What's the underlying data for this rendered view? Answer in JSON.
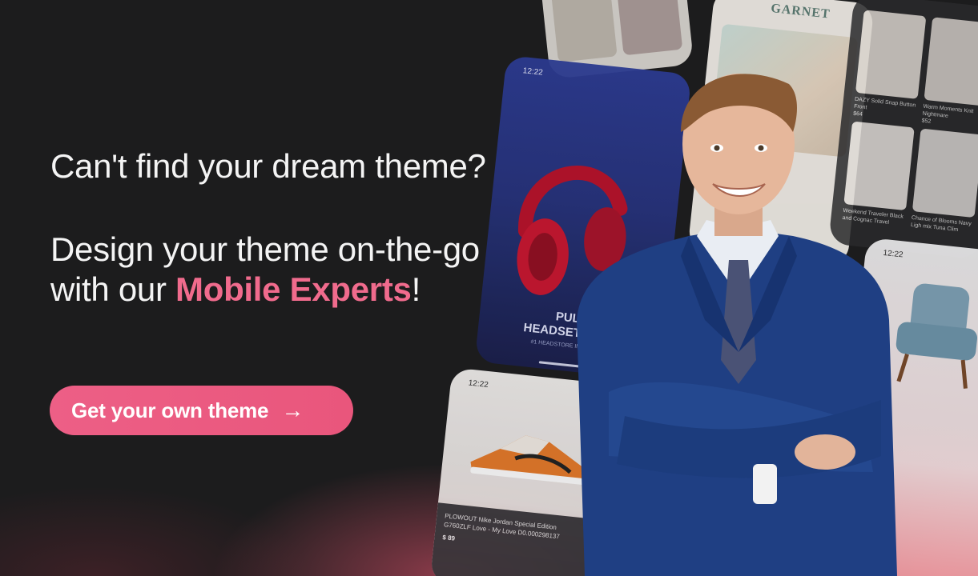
{
  "headline": {
    "line1": "Can't find your dream theme?",
    "line2": "Design your theme on-the-go",
    "line3_prefix": "with our ",
    "line3_accent": "Mobile Experts",
    "line3_suffix": "!"
  },
  "cta": {
    "label": "Get your own theme",
    "arrow": "→"
  },
  "mockups": {
    "headset": {
      "time": "12:22",
      "title_line1": "PULSE",
      "title_line2": "HEADSET STORE",
      "subtitle": "#1 HEADSTORE IN THE WORLD"
    },
    "garnet": {
      "logo": "GARNET"
    },
    "grid": {
      "item1": "DAZY Solid Snap Button Front",
      "item1_price": "$64",
      "item2": "Warm Moments Knit Nightmare",
      "item2_price": "$52",
      "item3": "Weekend Traveler Black and Cognac Travel",
      "item4": "Chance of Blooms Navy Ligh mix Tuna Clim"
    },
    "shoe": {
      "time": "12:22",
      "name": "PLOWOUT Nike Jordan Special Edition G760ZLF Love - My Love D0.000298137",
      "price": "$ 89"
    },
    "chair": {
      "time": "12:22"
    }
  },
  "colors": {
    "background": "#1c1c1d",
    "accent": "#f06b8d",
    "cta": "#eb5b82",
    "text": "#f4f4f4"
  }
}
